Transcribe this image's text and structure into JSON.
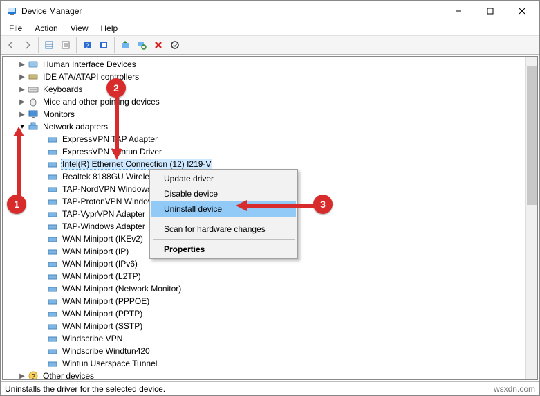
{
  "window": {
    "title": "Device Manager"
  },
  "menu": {
    "file": "File",
    "action": "Action",
    "view": "View",
    "help": "Help"
  },
  "tree": {
    "hid": "Human Interface Devices",
    "ide": "IDE ATA/ATAPI controllers",
    "keyboards": "Keyboards",
    "mice": "Mice and other pointing devices",
    "monitors": "Monitors",
    "netadapters": "Network adapters",
    "adapters": [
      "ExpressVPN TAP Adapter",
      "ExpressVPN Wintun Driver",
      "Intel(R) Ethernet Connection (12) I219-V",
      "Realtek 8188GU Wireless",
      "TAP-NordVPN Windows",
      "TAP-ProtonVPN Windows",
      "TAP-VyprVPN Adapter",
      "TAP-Windows Adapter",
      "WAN Miniport (IKEv2)",
      "WAN Miniport (IP)",
      "WAN Miniport (IPv6)",
      "WAN Miniport (L2TP)",
      "WAN Miniport (Network Monitor)",
      "WAN Miniport (PPPOE)",
      "WAN Miniport (PPTP)",
      "WAN Miniport (SSTP)",
      "Windscribe VPN",
      "Windscribe Windtun420",
      "Wintun Userspace Tunnel"
    ],
    "other": "Other devices"
  },
  "context_menu": {
    "update": "Update driver",
    "disable": "Disable device",
    "uninstall": "Uninstall device",
    "scan": "Scan for hardware changes",
    "properties": "Properties"
  },
  "statusbar": {
    "text": "Uninstalls the driver for the selected device.",
    "watermark": "wsxdn.com"
  },
  "callouts": {
    "c1": "1",
    "c2": "2",
    "c3": "3"
  }
}
